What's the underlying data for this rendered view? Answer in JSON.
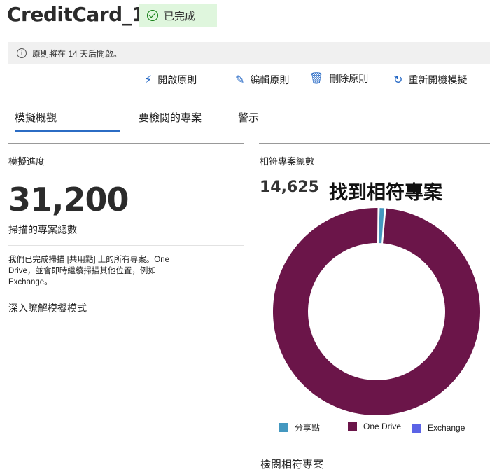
{
  "header": {
    "title": "CreditCard_1",
    "status_badge": "已完成",
    "status_color": "#dff6dd"
  },
  "info_bar": {
    "icon": "info-icon",
    "text": "原則將在 14 天后開啟。"
  },
  "toolbar": [
    {
      "icon": "lightning-icon",
      "label": "開啟原則"
    },
    {
      "icon": "pencil-icon",
      "label": "編輯原則"
    },
    {
      "icon": "trash-icon",
      "label": "刪除原則"
    },
    {
      "icon": "refresh-icon",
      "label": "重新開機模擬"
    }
  ],
  "tabs": [
    {
      "label": "模擬概觀",
      "active": true
    },
    {
      "label": "要檢閱的專案",
      "active": false
    },
    {
      "label": "警示",
      "active": false
    }
  ],
  "left_panel": {
    "heading": "模擬進度",
    "total_value": "31,200",
    "total_label": "掃描的專案總數",
    "description": "我們已完成掃描 [共用點] 上的所有專案。One Drive，並會即時繼續掃描其他位置，例如 Exchange。",
    "learn_more": "深入瞭解模擬模式"
  },
  "right_panel": {
    "heading": "相符專案總數",
    "match_value": "14,625",
    "match_label": "找到相符專案",
    "review_link": "檢閱相符專案"
  },
  "chart_data": {
    "type": "pie",
    "donut": true,
    "title": "相符專案總數",
    "categories": [
      "分享點",
      "One Drive",
      "Exchange"
    ],
    "values": [
      1,
      99,
      0
    ],
    "colors": [
      "#4498c0",
      "#6b1549",
      "#5b63e6"
    ],
    "legend": "bottom"
  }
}
